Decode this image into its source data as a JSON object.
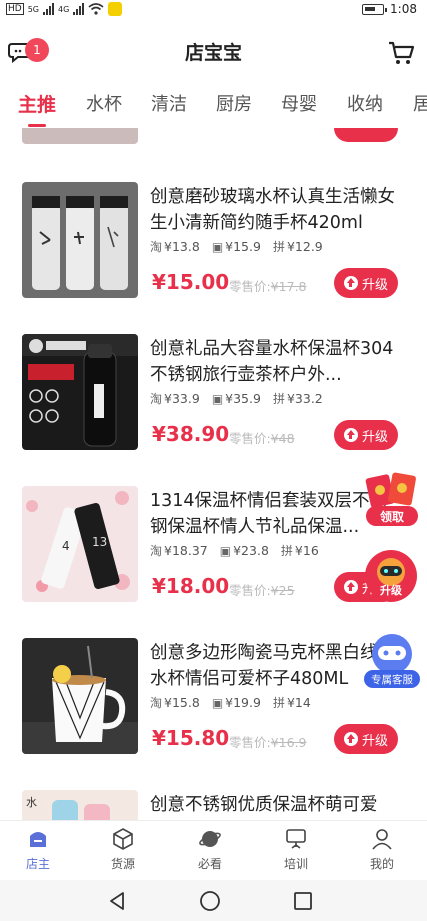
{
  "status": {
    "carrier_left": "HD",
    "carrier_right": "HD",
    "net1": "5G",
    "net2": "4G",
    "time": "1:08"
  },
  "header": {
    "title": "店宝宝",
    "badge_count": "1"
  },
  "tabs": [
    "主推",
    "水杯",
    "清洁",
    "厨房",
    "母婴",
    "收纳",
    "居"
  ],
  "labels": {
    "retail_prefix": "零售价:",
    "upgrade": "升级"
  },
  "products": [
    {
      "title": "创意磨砂玻璃水杯认真生活懒女生小清新简约随手杯420ml",
      "taobao": "¥13.8",
      "jd": "¥15.9",
      "pdd": "¥12.9",
      "price": "¥15.00",
      "retail": "¥17.8"
    },
    {
      "title": "创意礼品大容量水杯保温杯304不锈钢旅行壶茶杯户外...",
      "taobao": "¥33.9",
      "jd": "¥35.9",
      "pdd": "¥33.2",
      "price": "¥38.90",
      "retail": "¥48"
    },
    {
      "title": "1314保温杯情侣套装双层不锈钢保温杯情人节礼品保温...",
      "taobao": "¥18.37",
      "jd": "¥23.8",
      "pdd": "¥16",
      "price": "¥18.00",
      "retail": "¥25"
    },
    {
      "title": "创意多边形陶瓷马克杯黑白线条水杯情侣可爱杯子480ML",
      "taobao": "¥15.8",
      "jd": "¥19.9",
      "pdd": "¥14",
      "price": "¥15.80",
      "retail": "¥16.9"
    },
    {
      "title": "创意不锈钢优质保温杯萌可爱",
      "taobao": "",
      "jd": "",
      "pdd": "",
      "price": "",
      "retail": ""
    }
  ],
  "floating": {
    "redpacket": "领取",
    "robot": "升级",
    "service": "专属客服"
  },
  "bottom_nav": [
    "店主",
    "货源",
    "必看",
    "培训",
    "我的"
  ],
  "colors": {
    "accent": "#e8304a",
    "nav_active": "#5a6fd8"
  }
}
